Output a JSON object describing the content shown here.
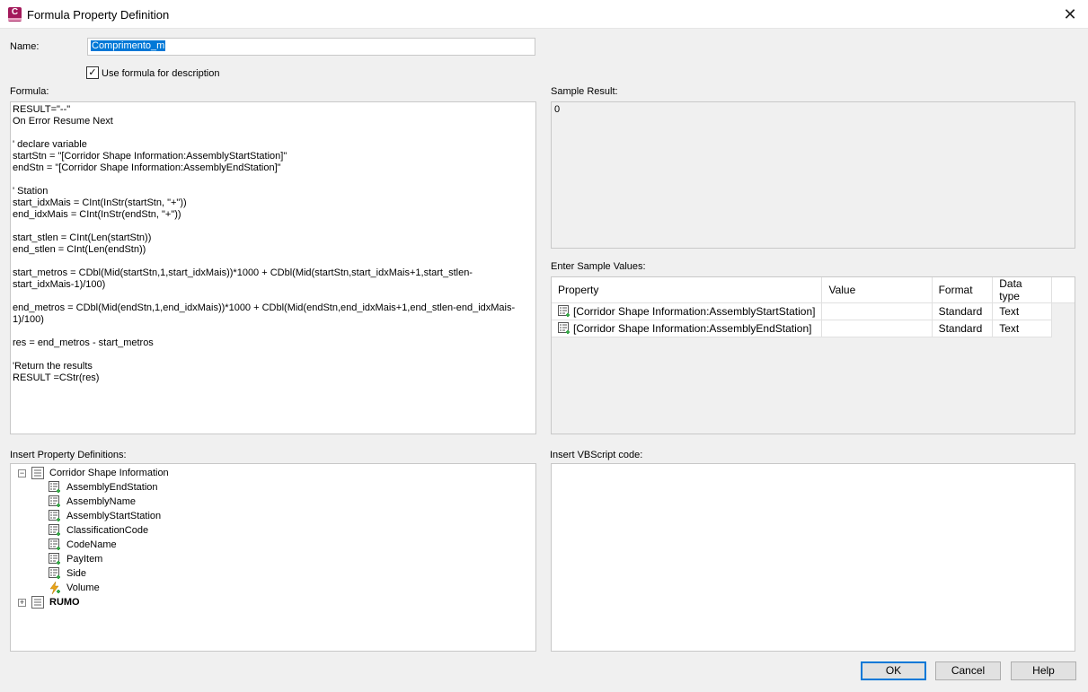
{
  "window": {
    "title": "Formula Property Definition",
    "app_icon": "C"
  },
  "name": {
    "label": "Name:",
    "value": "Comprimento_m"
  },
  "use_formula": {
    "label": "Use formula for description",
    "checked": true
  },
  "formula": {
    "label": "Formula:",
    "lines": [
      "RESULT=\"--\"",
      "On Error Resume Next",
      "",
      "' declare variable",
      "startStn = \"[Corridor Shape Information:AssemblyStartStation]\"",
      "endStn = \"[Corridor Shape Information:AssemblyEndStation]\"",
      "",
      "' Station",
      "start_idxMais = CInt(InStr(startStn, \"+\"))",
      "end_idxMais = CInt(InStr(endStn, \"+\"))",
      "",
      "start_stlen = CInt(Len(startStn))",
      "end_stlen = CInt(Len(endStn))",
      "",
      "start_metros = CDbl(Mid(startStn,1,start_idxMais))*1000 + CDbl(Mid(startStn,start_idxMais+1,start_stlen-",
      "start_idxMais-1)/100)",
      "",
      "end_metros = CDbl(Mid(endStn,1,end_idxMais))*1000 + CDbl(Mid(endStn,end_idxMais+1,end_stlen-end_idxMais-",
      "1)/100)",
      "",
      "res = end_metros - start_metros",
      "",
      "'Return the results",
      "RESULT =CStr(res)"
    ]
  },
  "sample_result": {
    "label": "Sample Result:",
    "value": "0"
  },
  "sample_values": {
    "label": "Enter Sample Values:",
    "columns": [
      "Property",
      "Value",
      "Format",
      "Data type"
    ],
    "rows": [
      {
        "property": "[Corridor Shape Information:AssemblyStartStation]",
        "value": "",
        "format": "Standard",
        "data_type": "Text"
      },
      {
        "property": "[Corridor Shape Information:AssemblyEndStation]",
        "value": "",
        "format": "Standard",
        "data_type": "Text"
      }
    ]
  },
  "property_definitions": {
    "label": "Insert Property Definitions:",
    "groups": [
      {
        "name": "Corridor Shape Information",
        "expanded": true,
        "items": [
          "AssemblyEndStation",
          "AssemblyName",
          "AssemblyStartStation",
          "ClassificationCode",
          "CodeName",
          "PayItem",
          "Side",
          "Volume"
        ]
      },
      {
        "name": "RUMO",
        "expanded": false
      }
    ]
  },
  "vbscript": {
    "label": "Insert VBScript code:"
  },
  "buttons": {
    "ok": "OK",
    "cancel": "Cancel",
    "help": "Help"
  },
  "colors": {
    "accent": "#0078d7",
    "app_brand": "#a3195b",
    "prop_icon_green": "#3aa84a"
  }
}
